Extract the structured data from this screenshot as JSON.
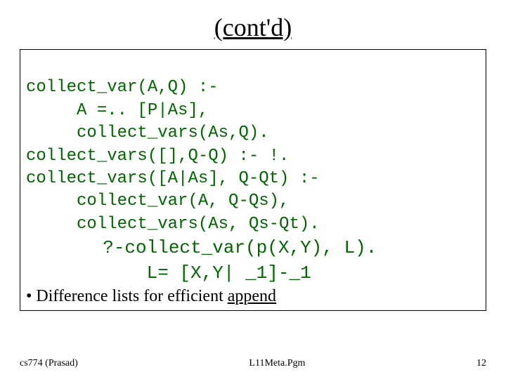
{
  "title": "(cont'd)",
  "code": {
    "l1": "collect_var(A,Q) :-",
    "l2": "     A =.. [P|As],",
    "l3": "     collect_vars(As,Q).",
    "l4": "collect_vars([],Q-Q) :- !.",
    "l5": "collect_vars([A|As], Q-Qt) :-",
    "l6": "     collect_var(A, Q-Qs),",
    "l7": "     collect_vars(As, Qs-Qt).",
    "l8": "       ?-collect_var(p(X,Y), L).",
    "l9": "           L= [X,Y| _1]-_1"
  },
  "bullet_prefix": "• Difference lists for efficient ",
  "bullet_underlined": "append",
  "footer": {
    "left": "cs774 (Prasad)",
    "center": "L11Meta.Pgm",
    "right": "12"
  }
}
